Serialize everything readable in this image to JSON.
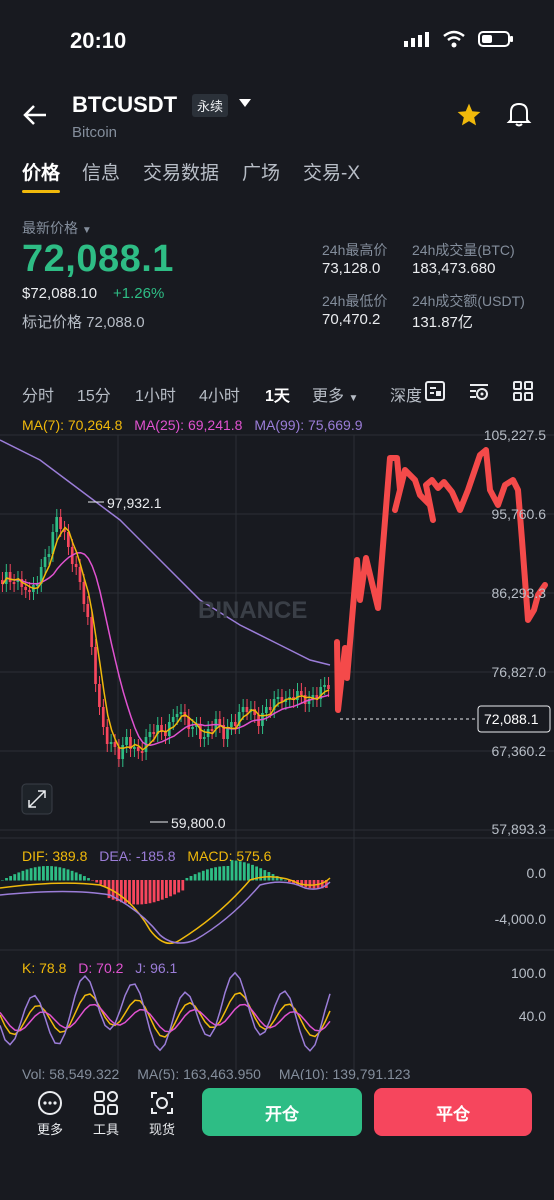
{
  "status": {
    "time": "20:10"
  },
  "header": {
    "symbol": "BTCUSDT",
    "contract": "永续",
    "name": "Bitcoin"
  },
  "tabs": [
    "价格",
    "信息",
    "交易数据",
    "广场",
    "交易-X"
  ],
  "price": {
    "label": "最新价格",
    "last": "72,088.1",
    "usd": "$72,088.10",
    "change": "+1.26%",
    "mark": "标记价格 72,088.0"
  },
  "stats": {
    "high_label": "24h最高价",
    "high": "73,128.0",
    "vol_label": "24h成交量(BTC)",
    "vol": "183,473.680",
    "low_label": "24h最低价",
    "low": "70,470.2",
    "amount_label": "24h成交额(USDT)",
    "amount": "131.87亿"
  },
  "intervals": [
    "分时",
    "15分",
    "1小时",
    "4小时",
    "1天",
    "更多",
    "深度"
  ],
  "ma": {
    "ma7": "MA(7): 70,264.8",
    "ma25": "MA(25): 69,241.8",
    "ma99": "MA(99): 75,669.9"
  },
  "axis": [
    "105,227.5",
    "95,760.6",
    "86,293.3",
    "76,827.0",
    "67,360.2",
    "57,893.3"
  ],
  "current_price_tag": "72,088.1",
  "annotations": {
    "high": "97,932.1",
    "low": "59,800.0"
  },
  "watermark": "BINANCE",
  "macd": {
    "dif": "DIF: 389.8",
    "dea": "DEA: -185.8",
    "macd": "MACD: 575.6",
    "axis_top": "0.0",
    "axis_bottom": "-4,000.0"
  },
  "kdj": {
    "k": "K: 78.8",
    "d": "D: 70.2",
    "j": "J: 96.1",
    "axis_top": "100.0",
    "axis_mid": "40.0"
  },
  "vol_legend": {
    "vol": "Vol: 58,549.322",
    "ma5": "MA(5): 163,463.950",
    "ma10": "MA(10): 139,791.123"
  },
  "bottom": {
    "more": "更多",
    "tools": "工具",
    "spot": "现货",
    "open": "开仓",
    "close": "平仓"
  },
  "colors": {
    "up": "#2ebd85",
    "down": "#f6465d",
    "accent": "#f0b90b",
    "ma7": "#f0b90b",
    "ma25": "#e052d0",
    "ma99": "#9b7dd8"
  }
}
